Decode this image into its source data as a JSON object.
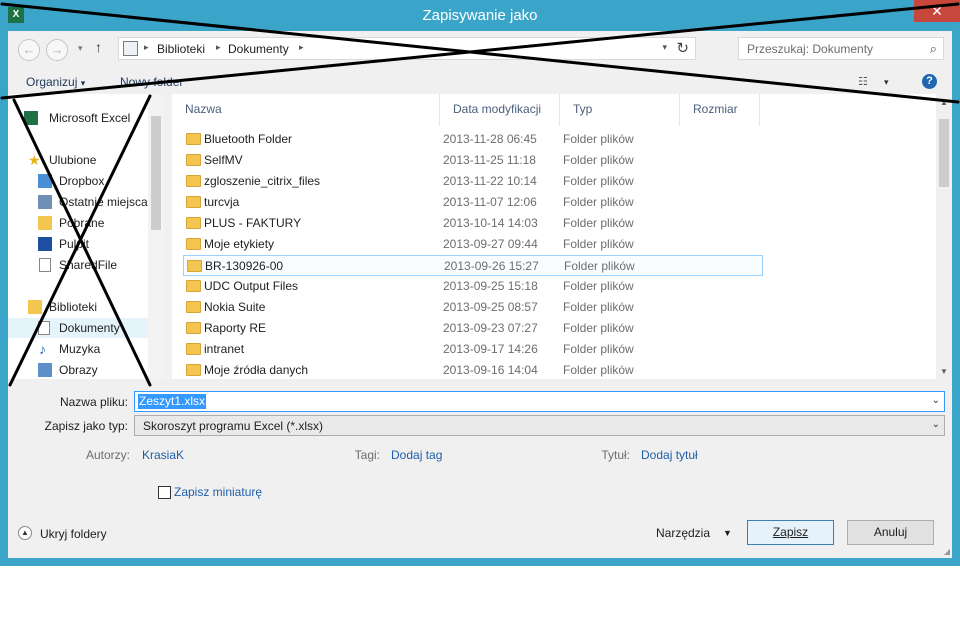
{
  "window": {
    "title": "Zapisywanie jako",
    "app_icon": "excel-icon",
    "close_glyph": "✕"
  },
  "address": {
    "crumbs": [
      "Biblioteki",
      "Dokumenty"
    ],
    "search_placeholder": "Przeszukaj: Dokumenty"
  },
  "toolbar": {
    "organize_label": "Organizuj",
    "new_folder_label": "Nowy folder"
  },
  "nav": {
    "items": [
      {
        "label": "Microsoft Excel",
        "icon": "excel-icon"
      },
      {
        "label": "Ulubione",
        "icon": "star-icon"
      },
      {
        "label": "Dropbox",
        "icon": "dropbox-icon"
      },
      {
        "label": "Ostatnie miejsca",
        "icon": "recent-places-icon"
      },
      {
        "label": "Pobrane",
        "icon": "downloads-icon"
      },
      {
        "label": "Pulpit",
        "icon": "desktop-icon"
      },
      {
        "label": "SharedFile",
        "icon": "file-icon"
      },
      {
        "label": "Biblioteki",
        "icon": "libraries-icon"
      },
      {
        "label": "Dokumenty",
        "icon": "documents-icon"
      },
      {
        "label": "Muzyka",
        "icon": "music-icon"
      },
      {
        "label": "Obrazy",
        "icon": "pictures-icon"
      }
    ]
  },
  "columns": {
    "name": "Nazwa",
    "date": "Data modyfikacji",
    "type": "Typ",
    "size": "Rozmiar"
  },
  "files": [
    {
      "name": "Bluetooth Folder",
      "date": "2013-11-28 06:45",
      "type": "Folder plików"
    },
    {
      "name": "SelfMV",
      "date": "2013-11-25 11:18",
      "type": "Folder plików"
    },
    {
      "name": "zgloszenie_citrix_files",
      "date": "2013-11-22 10:14",
      "type": "Folder plików"
    },
    {
      "name": "turcvja",
      "date": "2013-11-07 12:06",
      "type": "Folder plików"
    },
    {
      "name": "PLUS - FAKTURY",
      "date": "2013-10-14 14:03",
      "type": "Folder plików"
    },
    {
      "name": "Moje etykiety",
      "date": "2013-09-27 09:44",
      "type": "Folder plików"
    },
    {
      "name": "BR-130926-00",
      "date": "2013-09-26 15:27",
      "type": "Folder plików"
    },
    {
      "name": "UDC Output Files",
      "date": "2013-09-25 15:18",
      "type": "Folder plików"
    },
    {
      "name": "Nokia Suite",
      "date": "2013-09-25 08:57",
      "type": "Folder plików"
    },
    {
      "name": "Raporty RE",
      "date": "2013-09-23 07:27",
      "type": "Folder plików"
    },
    {
      "name": "intranet",
      "date": "2013-09-17 14:26",
      "type": "Folder plików"
    },
    {
      "name": "Moje źródła danych",
      "date": "2013-09-16 14:04",
      "type": "Folder plików"
    }
  ],
  "form": {
    "filename_label": "Nazwa pliku:",
    "filename_value": "Zeszyt1.xlsx",
    "filetype_label": "Zapisz jako typ:",
    "filetype_value": "Skoroszyt programu Excel (*.xlsx)",
    "authors_label": "Autorzy:",
    "authors_value": "KrasiaK",
    "tags_label": "Tagi:",
    "tags_value": "Dodaj tag",
    "title_label": "Tytuł:",
    "title_value": "Dodaj tytuł",
    "thumbnail_label": "Zapisz miniaturę"
  },
  "footer": {
    "hide_folders_label": "Ukryj foldery",
    "tools_label": "Narzędzia",
    "save_label": "Zapisz",
    "cancel_label": "Anuluj"
  }
}
